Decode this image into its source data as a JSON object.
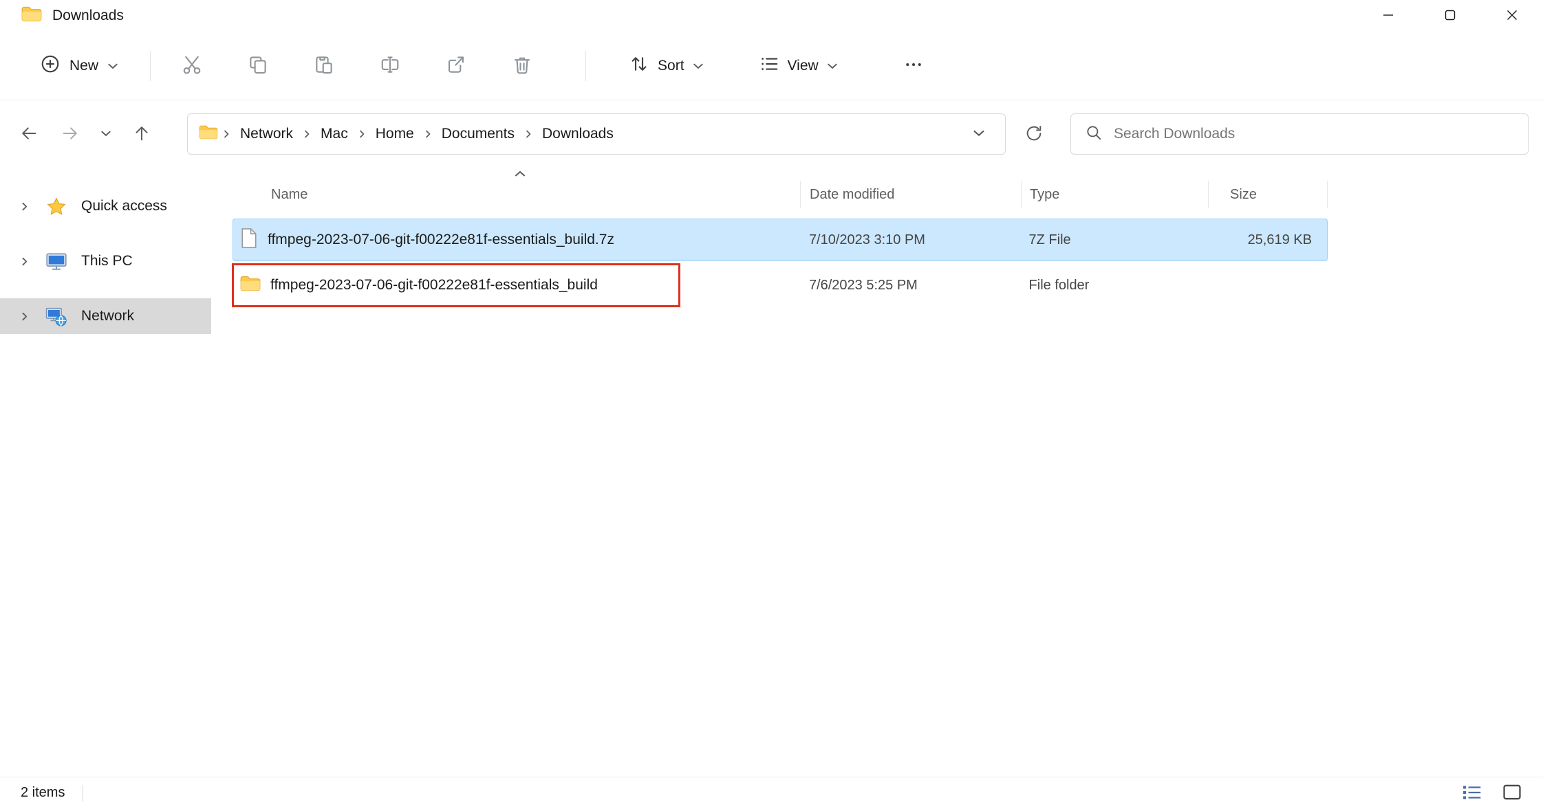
{
  "window": {
    "title": "Downloads"
  },
  "toolbar": {
    "new_label": "New",
    "sort_label": "Sort",
    "view_label": "View"
  },
  "navbar": {
    "breadcrumb": [
      "Network",
      "Mac",
      "Home",
      "Documents",
      "Downloads"
    ],
    "search_placeholder": "Search Downloads"
  },
  "sidebar": {
    "items": [
      {
        "label": "Quick access"
      },
      {
        "label": "This PC"
      },
      {
        "label": "Network"
      }
    ]
  },
  "files": {
    "columns": {
      "name": "Name",
      "date_modified": "Date modified",
      "type": "Type",
      "size": "Size"
    },
    "rows": [
      {
        "name": "ffmpeg-2023-07-06-git-f00222e81f-essentials_build.7z",
        "date_modified": "7/10/2023 3:10 PM",
        "type": "7Z File",
        "size": "25,619 KB"
      },
      {
        "name": "ffmpeg-2023-07-06-git-f00222e81f-essentials_build",
        "date_modified": "7/6/2023 5:25 PM",
        "type": "File folder",
        "size": ""
      }
    ]
  },
  "statusbar": {
    "item_count": "2 items"
  },
  "icons": {
    "titlebar": "folder-icon",
    "toolbar": [
      "new-plus-icon",
      "cut-icon",
      "copy-icon",
      "paste-icon",
      "rename-icon",
      "share-icon",
      "delete-icon",
      "sort-icon",
      "view-icon",
      "more-icon"
    ],
    "navbar": [
      "back-icon",
      "forward-icon",
      "recent-chevron-icon",
      "up-icon",
      "folder-icon",
      "refresh-icon",
      "search-icon"
    ],
    "sidebar": [
      "star-icon",
      "monitor-icon",
      "network-icon"
    ],
    "statusbar": [
      "details-view-icon",
      "thumbnail-view-icon"
    ]
  },
  "colors": {
    "selection_blue": "#cce8ff",
    "selection_border": "#9ecff5",
    "highlight_red": "#e0301e",
    "folder_yellow": "#ffd04a",
    "sidebar_selected": "#d9d9d9"
  }
}
